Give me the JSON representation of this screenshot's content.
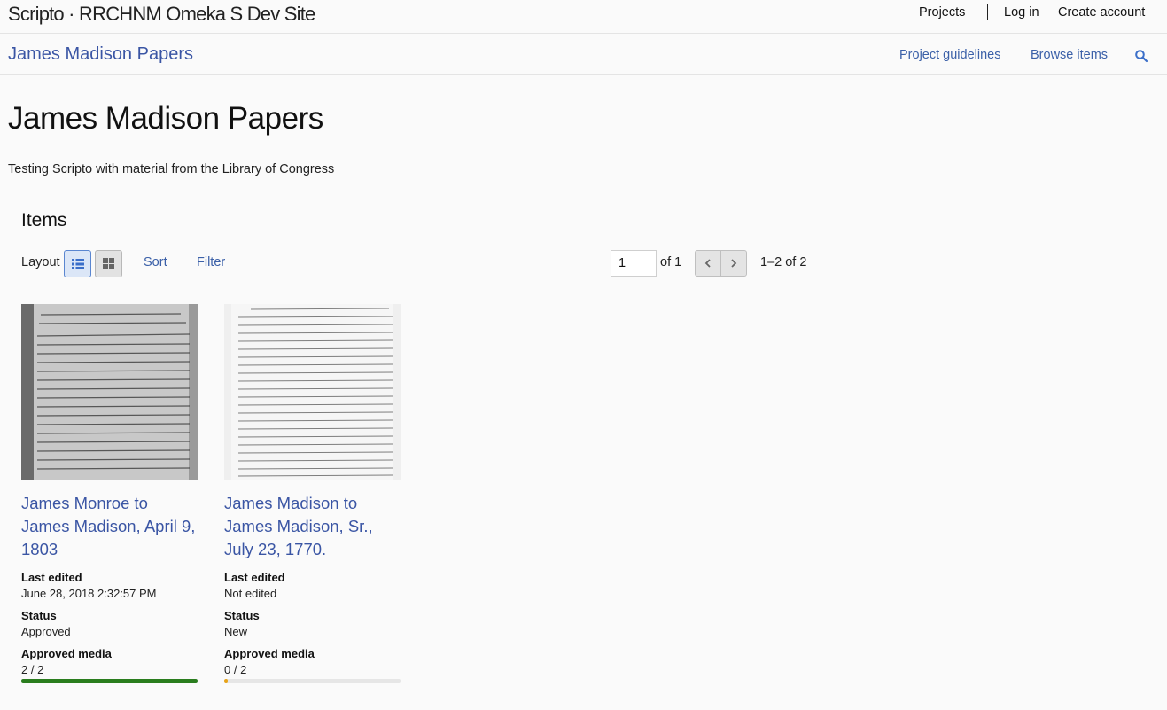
{
  "site": {
    "title": "Scripto · RRCHNM Omeka S Dev Site",
    "nav": {
      "projects": "Projects",
      "login": "Log in",
      "create_account": "Create account"
    }
  },
  "project": {
    "title": "James Madison Papers",
    "nav": {
      "guidelines": "Project guidelines",
      "browse": "Browse items"
    }
  },
  "page": {
    "title": "James Madison Papers",
    "description": "Testing Scripto with material from the Library of Congress"
  },
  "items": {
    "heading": "Items",
    "layout_label": "Layout",
    "sort_label": "Sort",
    "filter_label": "Filter",
    "page_value": "1",
    "page_total_text": "of 1",
    "count_text": "1–2 of 2",
    "list": [
      {
        "title": "James Monroe to James Madison, April 9, 1803",
        "last_edited_label": "Last edited",
        "last_edited": "June 28, 2018 2:32:57 PM",
        "status_label": "Status",
        "status": "Approved",
        "media_label": "Approved media",
        "media": "2 / 2",
        "progress": 1.0,
        "progress_color": "#2a7d1e"
      },
      {
        "title": "James Madison to James Madison, Sr., July 23, 1770.",
        "last_edited_label": "Last edited",
        "last_edited": "Not edited",
        "status_label": "Status",
        "status": "New",
        "media_label": "Approved media",
        "media": "0 / 2",
        "progress": 0.0,
        "progress_color": "#e8a317"
      }
    ]
  },
  "colors": {
    "link": "#3b60a8",
    "title_link": "#3a55a4",
    "approved": "#2a7d1e",
    "pending": "#e8a317"
  }
}
